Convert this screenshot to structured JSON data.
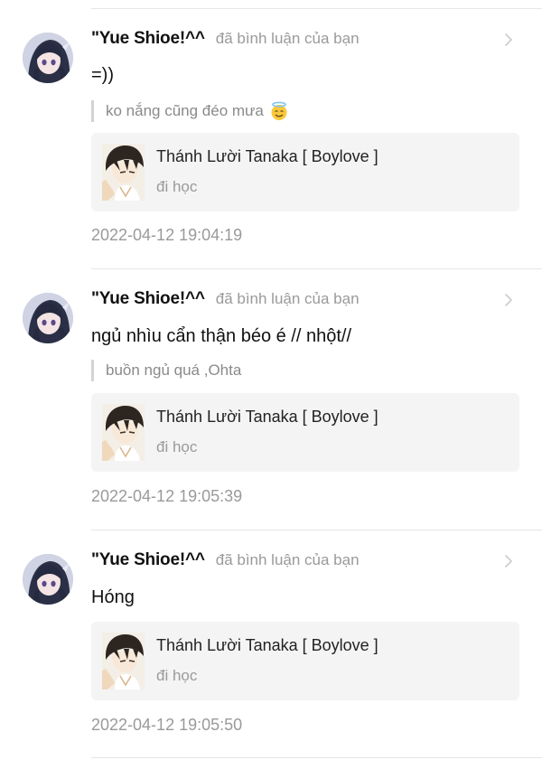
{
  "notifications": [
    {
      "username": "\"Yue Shioe!^^",
      "action": "đã bình luận của bạn",
      "comment": "=))",
      "quote": "ko nắng cũng đéo mưa",
      "quote_emoji": "smiling-face-with-halo-emoji",
      "post_title": "Thánh Lười Tanaka [ Boylove ]",
      "post_text": "đi học",
      "timestamp": "2022-04-12 19:04:19"
    },
    {
      "username": "\"Yue Shioe!^^",
      "action": "đã bình luận của bạn",
      "comment": "ngủ nhìu cẩn thận béo é // nhột//",
      "quote": "buồn ngủ quá ,Ohta",
      "post_title": "Thánh Lười Tanaka [ Boylove ]",
      "post_text": "đi học",
      "timestamp": "2022-04-12 19:05:39"
    },
    {
      "username": "\"Yue Shioe!^^",
      "action": "đã bình luận của bạn",
      "comment": "Hóng",
      "post_title": "Thánh Lười Tanaka [ Boylove ]",
      "post_text": "đi học",
      "timestamp": "2022-04-12 19:05:50"
    }
  ],
  "colors": {
    "background": "#ffffff",
    "divider": "#e6e6e6",
    "card_background": "#f4f4f5",
    "muted_text": "#9a9a9a",
    "primary_text": "#111111"
  }
}
